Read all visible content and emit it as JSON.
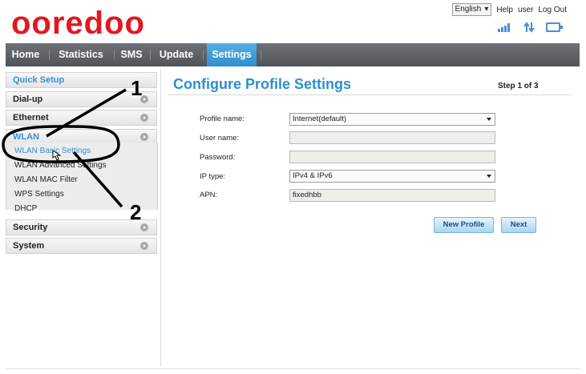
{
  "brand": {
    "logo_text": "ooredoo",
    "color": "#e4171f"
  },
  "topbar": {
    "language": "English",
    "help": "Help",
    "user": "user",
    "logout": "Log Out"
  },
  "status_icons": [
    "signal-icon",
    "data-transfer-icon",
    "monitor-icon"
  ],
  "nav": {
    "items": [
      "Home",
      "Statistics",
      "SMS",
      "Update",
      "Settings"
    ],
    "active": "Settings"
  },
  "sidebar": {
    "quick_setup": "Quick Setup",
    "dialup": "Dial-up",
    "ethernet": "Ethernet",
    "wlan": "WLAN",
    "wlan_sub": [
      "WLAN Basic Settings",
      "WLAN Advanced Settings",
      "WLAN MAC Filter",
      "WPS Settings",
      "DHCP"
    ],
    "security": "Security",
    "system": "System"
  },
  "main": {
    "title": "Configure Profile Settings",
    "step": "Step 1 of 3",
    "form": {
      "profile_name_label": "Profile name:",
      "profile_name_value": "Internet(default)",
      "user_name_label": "User name:",
      "user_name_value": "",
      "password_label": "Password:",
      "password_value": "",
      "ip_type_label": "IP type:",
      "ip_type_value": "IPv4 & IPv6",
      "apn_label": "APN:",
      "apn_value": "fixedhbb"
    },
    "buttons": {
      "new_profile": "New Profile",
      "next": "Next"
    }
  },
  "annotations": {
    "one": "1",
    "two": "2"
  },
  "colors": {
    "accent": "#2d8ed0",
    "nav_bg": "#5a5e63",
    "nav_active": "#3a9ad8"
  }
}
